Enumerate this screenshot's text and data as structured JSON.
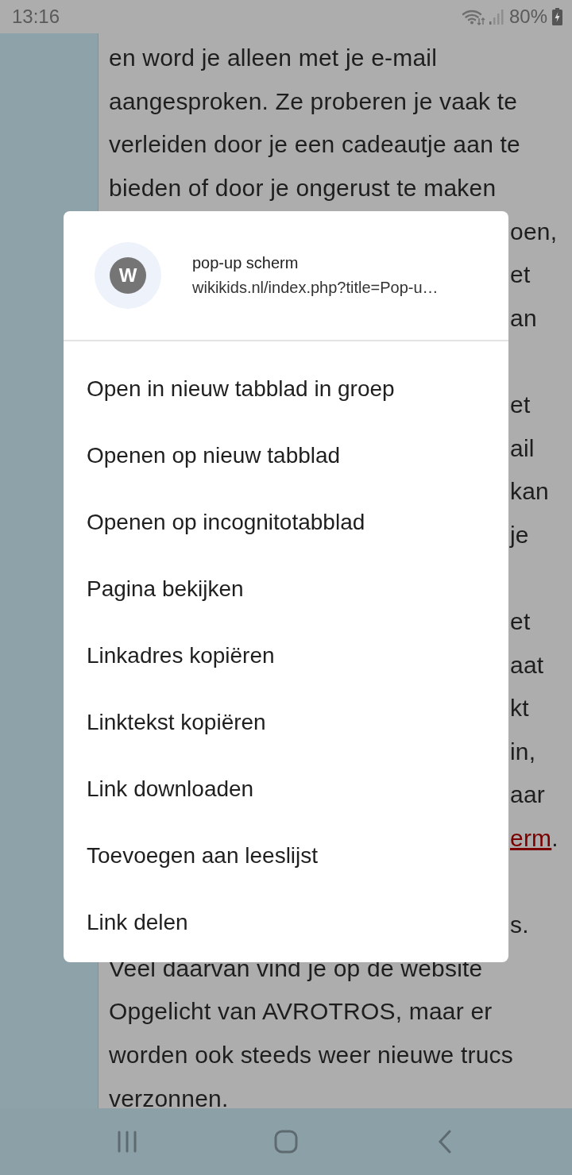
{
  "status_bar": {
    "time": "13:16",
    "battery": "80%"
  },
  "article": {
    "paragraphs": [
      {
        "lines": [
          {
            "text": "en word je alleen met je e-mail"
          },
          {
            "text": "aangesproken. Ze proberen je vaak te"
          },
          {
            "text": "verleiden door je een cadeautje aan te"
          },
          {
            "text": "bieden of door je ongerust te maken"
          },
          {
            "text": "oen,",
            "partial": true
          },
          {
            "text": "et",
            "partial": true
          },
          {
            "text": "an",
            "partial": true
          }
        ]
      },
      {
        "lines": [
          {
            "text": "et",
            "partial": true
          },
          {
            "text": "ail",
            "partial": true
          },
          {
            "text": "kan",
            "partial": true
          },
          {
            "text": "je",
            "partial": true
          }
        ]
      },
      {
        "lines": [
          {
            "text": "et",
            "partial": true
          },
          {
            "text": "aat",
            "partial": true
          },
          {
            "text": "kt",
            "partial": true
          },
          {
            "text": "in,",
            "partial": true
          },
          {
            "text": "aar",
            "partial": true
          },
          {
            "parts": [
              {
                "text": "erm",
                "link": true
              },
              {
                "text": "."
              }
            ],
            "partial": true
          }
        ]
      },
      {
        "lines": [
          {
            "text": "s.",
            "partial": true
          },
          {
            "text": "Veel daarvan vind je op de website"
          },
          {
            "text": "Opgelicht van AVROTROS, maar er"
          },
          {
            "text": "worden ook steeds weer nieuwe trucs"
          },
          {
            "text": "verzonnen."
          }
        ]
      }
    ]
  },
  "context_menu": {
    "avatar_letter": "W",
    "title": "pop-up scherm",
    "url": "wikikids.nl/index.php?title=Pop-u…",
    "items": [
      {
        "label": "Open in nieuw tabblad in groep"
      },
      {
        "label": "Openen op nieuw tabblad"
      },
      {
        "label": "Openen op incognitotabblad"
      },
      {
        "label": "Pagina bekijken"
      },
      {
        "label": "Linkadres kopiëren"
      },
      {
        "label": "Linktekst kopiëren"
      },
      {
        "label": "Link downloaden"
      },
      {
        "label": "Toevoegen aan leeslijst"
      },
      {
        "label": "Link delen"
      }
    ]
  }
}
